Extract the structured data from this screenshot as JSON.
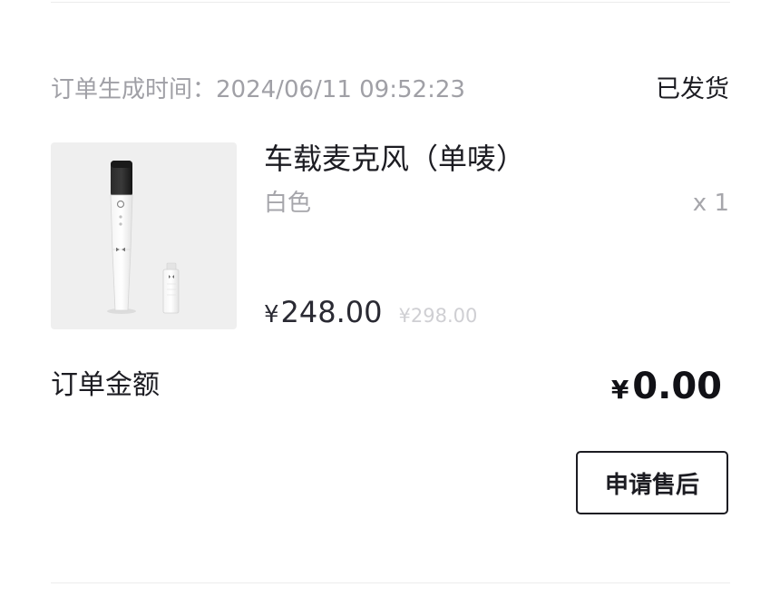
{
  "order": {
    "time_label": "订单生成时间：",
    "time_value": "2024/06/11 09:52:23",
    "status": "已发货"
  },
  "product": {
    "name": "车载麦克风（单唛）",
    "variant": "白色",
    "quantity": "x 1",
    "currency_symbol": "¥",
    "price": "248.00",
    "original_price": "¥298.00",
    "image_icon": "microphone-product-image"
  },
  "total": {
    "label": "订单金额",
    "currency_symbol": "¥",
    "value": "0.00"
  },
  "actions": {
    "after_sale_label": "申请售后"
  },
  "colors": {
    "text_primary": "#1c1c22",
    "text_secondary": "#a0a0a6",
    "thumb_background": "#efefef",
    "divider": "#ececec"
  }
}
